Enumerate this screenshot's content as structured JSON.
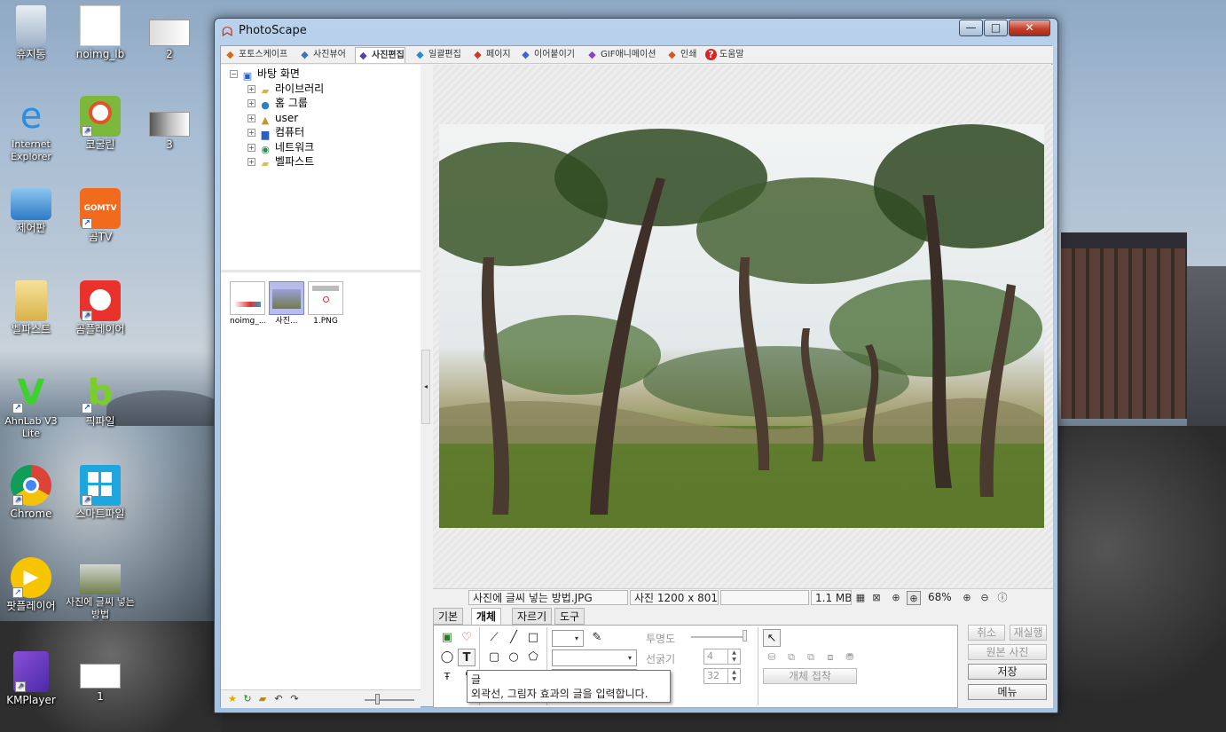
{
  "desktop": {
    "icons": [
      {
        "label": "휴지통",
        "icon": "recycle-bin-icon"
      },
      {
        "label": "noimg_lb",
        "icon": "image-file-icon"
      },
      {
        "label": "2",
        "icon": "image-file-icon"
      },
      {
        "label": "Internet Explorer",
        "icon": "internet-explorer-icon"
      },
      {
        "label": "코굴린",
        "icon": "magnifier-app-icon"
      },
      {
        "label": "3",
        "icon": "image-file-icon"
      },
      {
        "label": "제어판",
        "icon": "control-panel-icon"
      },
      {
        "label": "곰TV",
        "icon": "gomtv-icon",
        "badge": "GOMTV"
      },
      {
        "label": "벨파스트",
        "icon": "folder-icon"
      },
      {
        "label": "곰플레이어",
        "icon": "gom-player-icon"
      },
      {
        "label": "AhnLab V3 Lite",
        "icon": "ahnlab-v3-icon"
      },
      {
        "label": "픽파일",
        "icon": "pickfile-icon"
      },
      {
        "label": "Chrome",
        "icon": "chrome-icon"
      },
      {
        "label": "스마트파일",
        "icon": "smartfile-icon"
      },
      {
        "label": "팟플레이어",
        "icon": "potplayer-icon"
      },
      {
        "label": "사진에 글씨 넣는 방법",
        "icon": "photo-file-icon"
      },
      {
        "label": "KMPlayer",
        "icon": "kmplayer-icon"
      },
      {
        "label": "1",
        "icon": "image-file-icon"
      }
    ]
  },
  "window": {
    "title": "PhotoScape",
    "controls": {
      "minimize": "—",
      "maximize": "□",
      "close": "✕"
    }
  },
  "tabs": [
    {
      "label": "포토스케이프",
      "icon": "photoscape-icon"
    },
    {
      "label": "사진뷰어",
      "icon": "viewer-icon"
    },
    {
      "label": "사진편집",
      "icon": "editor-icon",
      "active": true
    },
    {
      "label": "일괄편집",
      "icon": "batch-icon"
    },
    {
      "label": "페이지",
      "icon": "page-icon"
    },
    {
      "label": "이어붙이기",
      "icon": "combine-icon"
    },
    {
      "label": "GIF애니메이션",
      "icon": "gif-icon"
    },
    {
      "label": "인쇄",
      "icon": "print-icon"
    },
    {
      "label": "도움말",
      "icon": "help-icon"
    }
  ],
  "tree": {
    "root": "바탕 화면",
    "children": [
      "라이브러리",
      "홈 그룹",
      "user",
      "컴퓨터",
      "네트워크",
      "벨파스트"
    ]
  },
  "thumbnails": [
    {
      "caption": "noimg_..."
    },
    {
      "caption": "사진..."
    },
    {
      "caption": "1.PNG"
    }
  ],
  "status": {
    "filename": "사진에 글씨 넣는 방법.JPG",
    "dimensions": "사진 1200 x 801",
    "filesize": "1.1 MB",
    "zoom": "68%"
  },
  "bottom_tabs": [
    {
      "label": "기본"
    },
    {
      "label": "개체",
      "active": true
    },
    {
      "label": "자르기"
    },
    {
      "label": "도구"
    }
  ],
  "object_panel": {
    "opacity_label": "투명도",
    "line_width_label": "선굵기",
    "line_width_value": "4",
    "size_value": "32",
    "object_attach": "개체 접착"
  },
  "side_buttons": {
    "undo": "취소",
    "redo": "재실행",
    "original": "원본 사진",
    "save": "저장",
    "menu": "메뉴"
  },
  "tooltip": {
    "title": "글",
    "desc": "외곽선, 그림자 효과의 글을 입력합니다."
  },
  "colors": {
    "accent_close": "#c4402b",
    "selection": "#b7bde8"
  }
}
